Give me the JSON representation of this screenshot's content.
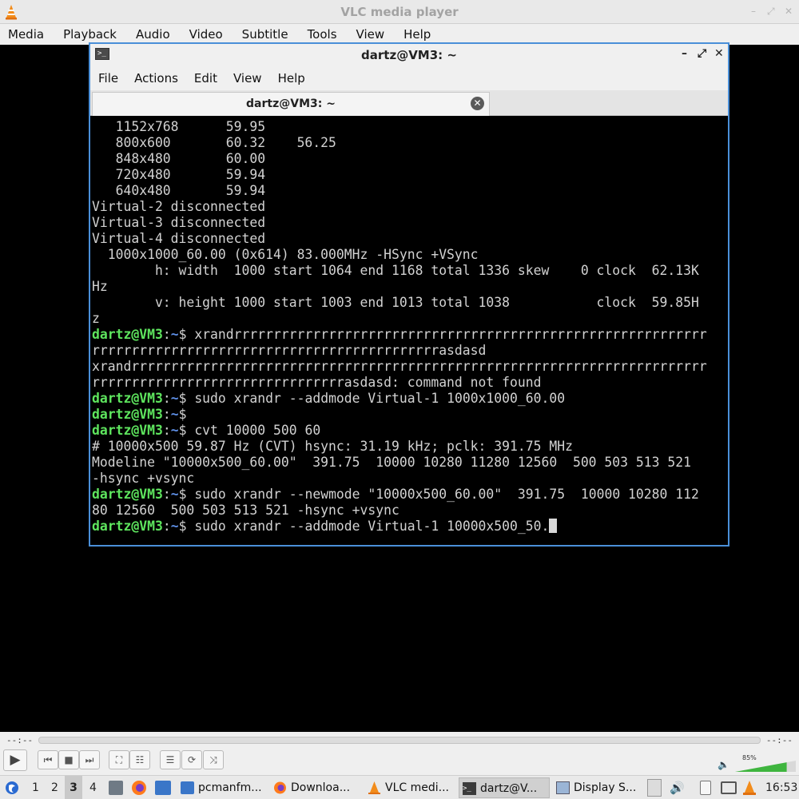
{
  "vlc": {
    "title": "VLC media player",
    "menu": [
      "Media",
      "Playback",
      "Audio",
      "Video",
      "Subtitle",
      "Tools",
      "View",
      "Help"
    ],
    "elapsed": "--:--",
    "remaining": "--:--",
    "volume": "85%",
    "volume_level": 0.85
  },
  "terminal": {
    "title": "dartz@VM3: ~",
    "menu": [
      "File",
      "Actions",
      "Edit",
      "View",
      "Help"
    ],
    "tab_label": "dartz@VM3: ~",
    "prompt_user": "dartz@VM3",
    "prompt_sep": ":",
    "prompt_dir": "~",
    "prompt_dollar": "$ ",
    "lines": [
      {
        "text": "   1152x768      59.95"
      },
      {
        "text": "   800x600       60.32    56.25"
      },
      {
        "text": "   848x480       60.00"
      },
      {
        "text": "   720x480       59.94"
      },
      {
        "text": "   640x480       59.94"
      },
      {
        "text": "Virtual-2 disconnected"
      },
      {
        "text": "Virtual-3 disconnected"
      },
      {
        "text": "Virtual-4 disconnected"
      },
      {
        "text": "  1000x1000_60.00 (0x614) 83.000MHz -HSync +VSync"
      },
      {
        "text": "        h: width  1000 start 1064 end 1168 total 1336 skew    0 clock  62.13K"
      },
      {
        "text": "Hz"
      },
      {
        "text": "        v: height 1000 start 1003 end 1013 total 1038           clock  59.85H"
      },
      {
        "text": "z"
      },
      {
        "prompt": true,
        "text": "xrandrrrrrrrrrrrrrrrrrrrrrrrrrrrrrrrrrrrrrrrrrrrrrrrrrrrrrrrrrrrr"
      },
      {
        "text": "rrrrrrrrrrrrrrrrrrrrrrrrrrrrrrrrrrrrrrrrrrrrasdasd"
      },
      {
        "text": "xrandrrrrrrrrrrrrrrrrrrrrrrrrrrrrrrrrrrrrrrrrrrrrrrrrrrrrrrrrrrrrrrrrrrrrrrrrr"
      },
      {
        "text": "rrrrrrrrrrrrrrrrrrrrrrrrrrrrrrrrasdasd: command not found"
      },
      {
        "prompt": true,
        "text": "sudo xrandr --addmode Virtual-1 1000x1000_60.00"
      },
      {
        "prompt": true,
        "text": ""
      },
      {
        "prompt": true,
        "text": "cvt 10000 500 60"
      },
      {
        "text": "# 10000x500 59.87 Hz (CVT) hsync: 31.19 kHz; pclk: 391.75 MHz"
      },
      {
        "text": "Modeline \"10000x500_60.00\"  391.75  10000 10280 11280 12560  500 503 513 521"
      },
      {
        "text": "-hsync +vsync"
      },
      {
        "prompt": true,
        "text": "sudo xrandr --newmode \"10000x500_60.00\"  391.75  10000 10280 112"
      },
      {
        "text": "80 12560  500 503 513 521 -hsync +vsync"
      },
      {
        "prompt": true,
        "text": "sudo xrandr --addmode Virtual-1 10000x500_50.",
        "cursor": true
      }
    ]
  },
  "taskbar": {
    "workspaces": [
      "1",
      "2",
      "3",
      "4"
    ],
    "active_workspace": "3",
    "tasks": [
      {
        "label": "pcmanfm...",
        "icon": "folder-icon"
      },
      {
        "label": "Downloa...",
        "icon": "firefox-icon"
      },
      {
        "label": "VLC medi...",
        "icon": "vlc-icon"
      },
      {
        "label": "dartz@V...",
        "icon": "terminal-icon",
        "active": true
      },
      {
        "label": "Display S...",
        "icon": "window-icon"
      }
    ],
    "clock": "16:53"
  }
}
